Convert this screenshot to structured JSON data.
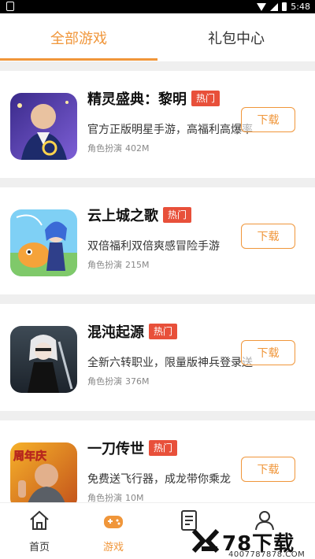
{
  "status_bar": {
    "time": "5:48"
  },
  "tabs": [
    {
      "label": "全部游戏",
      "active": true
    },
    {
      "label": "礼包中心",
      "active": false
    }
  ],
  "games": [
    {
      "title": "精灵盛典：黎明",
      "badge": "热门",
      "description": "官方正版明星手游，高福利高爆率",
      "category": "角色扮演",
      "size": "402M",
      "download_label": "下载"
    },
    {
      "title": "云上城之歌",
      "badge": "热门",
      "description": "双倍福利双倍爽感冒险手游",
      "category": "角色扮演",
      "size": "215M",
      "download_label": "下载"
    },
    {
      "title": "混沌起源",
      "badge": "热门",
      "description": "全新六转职业，限量版神兵登录送",
      "category": "角色扮演",
      "size": "376M",
      "download_label": "下载"
    },
    {
      "title": "一刀传世",
      "badge": "热门",
      "description": "免费送飞行器，成龙带你乘龙",
      "category": "角色扮演",
      "size": "10M",
      "download_label": "下载",
      "thumb_text": "周年庆"
    }
  ],
  "bottom_nav": [
    {
      "label": "首页",
      "icon": "home-icon",
      "active": false
    },
    {
      "label": "游戏",
      "icon": "gamepad-icon",
      "active": true
    },
    {
      "label": "",
      "icon": "document-icon",
      "active": false
    },
    {
      "label": "",
      "icon": "user-icon",
      "active": false
    }
  ],
  "watermark": {
    "brand": "78下载",
    "site": "4007787878.COM"
  },
  "colors": {
    "accent": "#f0963a",
    "hot_badge": "#e8503a",
    "separator": "#efefef"
  }
}
